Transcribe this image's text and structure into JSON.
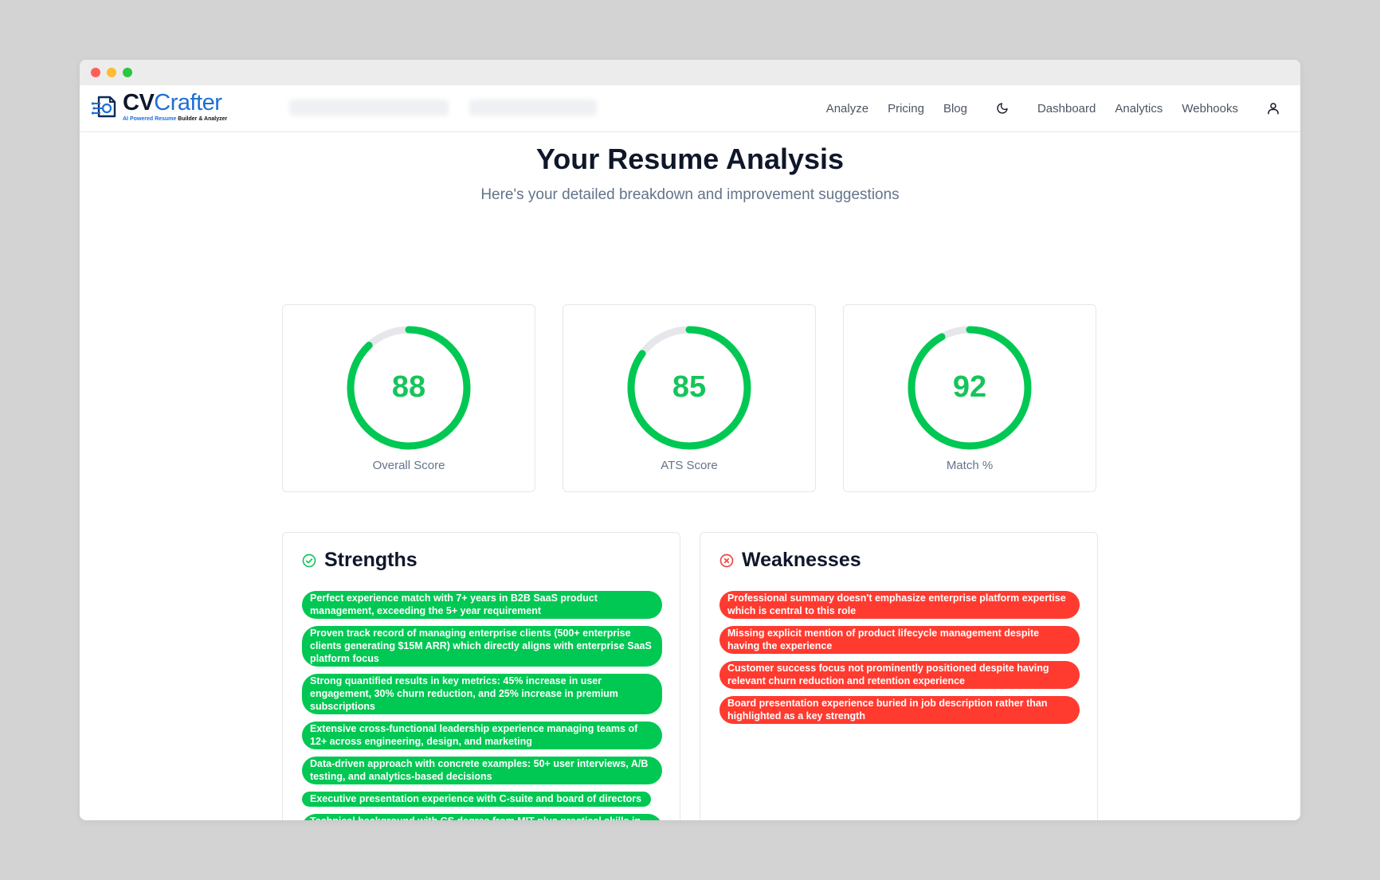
{
  "app": {
    "logo_main": "CV",
    "logo_accent": "Crafter",
    "tagline_accent": "AI Powered Resume",
    "tagline_rest": " Builder & Analyzer"
  },
  "nav": {
    "links": [
      "Analyze",
      "Pricing",
      "Blog",
      "Dashboard",
      "Analytics",
      "Webhooks"
    ],
    "theme_icon": "moon-icon",
    "user_icon": "user-icon"
  },
  "page": {
    "title": "Your Resume Analysis",
    "subtitle": "Here's your detailed breakdown and improvement suggestions"
  },
  "scores": [
    {
      "value": 88,
      "label": "Overall Score"
    },
    {
      "value": 85,
      "label": "ATS Score"
    },
    {
      "value": 92,
      "label": "Match %"
    }
  ],
  "colors": {
    "score_green": "#00c853",
    "ring_track": "#e5e7eb",
    "strength_green": "#00c853",
    "weakness_red": "#ff3b30",
    "brand_blue": "#1d6fd6"
  },
  "strengths": {
    "title": "Strengths",
    "icon": "check-circle-icon",
    "items": [
      "Perfect experience match with 7+ years in B2B SaaS product management, exceeding the 5+ year requirement",
      "Proven track record of managing enterprise clients (500+ enterprise clients generating $15M ARR) which directly aligns with enterprise SaaS platform focus",
      "Strong quantified results in key metrics: 45% increase in user engagement, 30% churn reduction, and 25% increase in premium subscriptions",
      "Extensive cross-functional leadership experience managing teams of 12+ across engineering, design, and marketing",
      "Data-driven approach with concrete examples: 50+ user interviews, A/B testing, and analytics-based decisions",
      "Executive presentation experience with C-suite and board of directors",
      "Technical background with CS degree from MIT plus practical skills in SQL, Python, and API integration"
    ]
  },
  "weaknesses": {
    "title": "Weaknesses",
    "icon": "x-circle-icon",
    "items": [
      "Professional summary doesn't emphasize enterprise platform expertise which is central to this role",
      "Missing explicit mention of product lifecycle management despite having the experience",
      "Customer success focus not prominently positioned despite having relevant churn reduction and retention experience",
      "Board presentation experience buried in job description rather than highlighted as a key strength"
    ]
  }
}
